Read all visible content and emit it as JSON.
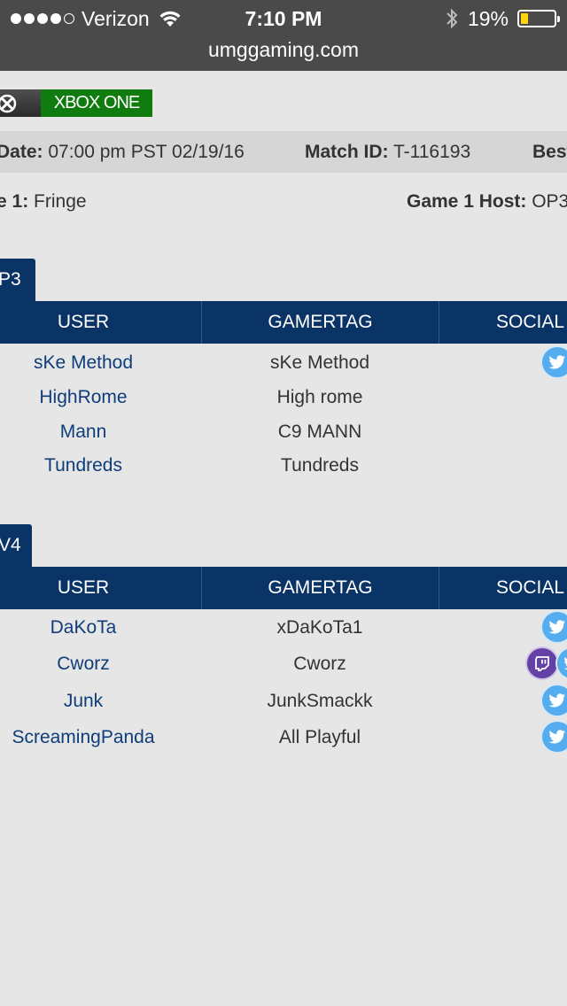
{
  "status": {
    "carrier": "Verizon",
    "time": "7:10 PM",
    "battery_pct": "19%",
    "battery_level": 0.19,
    "signal_bars": 4,
    "url": "umggaming.com"
  },
  "platform": {
    "name": "XBOX ONE"
  },
  "match_info": {
    "date_label": "Date:",
    "date_value": "07:00 pm PST 02/19/16",
    "match_id_label": "Match ID:",
    "match_id_value": "T-116193",
    "best_label": "Best",
    "game_label": "e 1:",
    "game_value": "Fringe",
    "host_label": "Game 1 Host:",
    "host_value": "OP3"
  },
  "teams": [
    {
      "tab": "P3",
      "headers": {
        "user": "USER",
        "gamertag": "GAMERTAG",
        "social": "SOCIAL M"
      },
      "rows": [
        {
          "user": "sKe Method",
          "gamertag": "sKe Method",
          "social": [
            "twitter"
          ]
        },
        {
          "user": "HighRome",
          "gamertag": "High rome",
          "social": []
        },
        {
          "user": "Mann",
          "gamertag": "C9 MANN",
          "social": []
        },
        {
          "user": "Tundreds",
          "gamertag": "Tundreds",
          "social": []
        }
      ]
    },
    {
      "tab": "V4",
      "headers": {
        "user": "USER",
        "gamertag": "GAMERTAG",
        "social": "SOCIAL M"
      },
      "rows": [
        {
          "user": "DaKoTa",
          "gamertag": "xDaKoTa1",
          "social": [
            "twitter"
          ]
        },
        {
          "user": "Cworz",
          "gamertag": "Cworz",
          "social": [
            "twitch",
            "twitter"
          ]
        },
        {
          "user": "Junk",
          "gamertag": "JunkSmackk",
          "social": [
            "twitter"
          ]
        },
        {
          "user": "ScreamingPanda",
          "gamertag": "All Playful",
          "social": [
            "twitter"
          ]
        }
      ]
    }
  ],
  "colors": {
    "navy": "#0a3466",
    "xbox_green": "#107c10",
    "twitter": "#55acee",
    "twitch": "#6441a5",
    "link": "#0f3d7a"
  }
}
